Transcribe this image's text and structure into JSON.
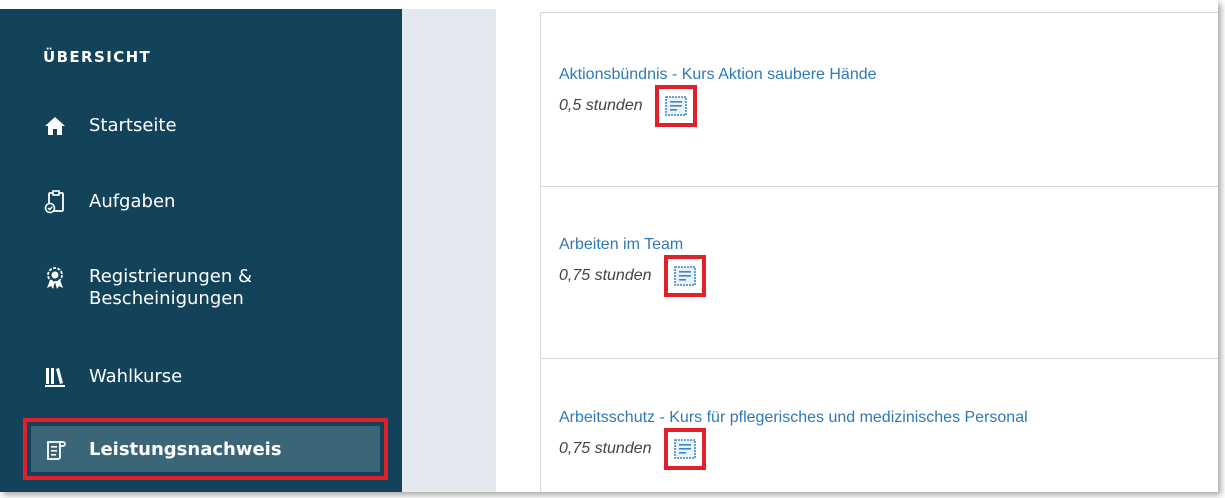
{
  "sidebar": {
    "section_title": "ÜBERSICHT",
    "items": [
      {
        "label": "Startseite",
        "icon": "home-icon"
      },
      {
        "label": "Aufgaben",
        "icon": "clipboard-check-icon"
      },
      {
        "label": "Registrierungen &",
        "label2": "Bescheinigungen",
        "icon": "award-ribbon-icon"
      },
      {
        "label": "Wahlkurse",
        "icon": "library-books-icon"
      },
      {
        "label": "Leistungsnachweis",
        "icon": "transcript-icon",
        "active": true
      }
    ]
  },
  "courses": [
    {
      "title": "Aktionsbündnis - Kurs Aktion saubere Hände",
      "duration": "0,5 stunden",
      "icon": "certificate-icon"
    },
    {
      "title": "Arbeiten im Team",
      "duration": "0,75 stunden",
      "icon": "certificate-icon"
    },
    {
      "title": "Arbeitsschutz - Kurs für pflegerisches und medizinisches Personal",
      "duration": "0,75 stunden",
      "icon": "certificate-icon"
    }
  ],
  "colors": {
    "sidebar_bg": "#13435a",
    "active_item_bg": "#3b6678",
    "highlight": "#e0202b",
    "link": "#2f79b8"
  }
}
